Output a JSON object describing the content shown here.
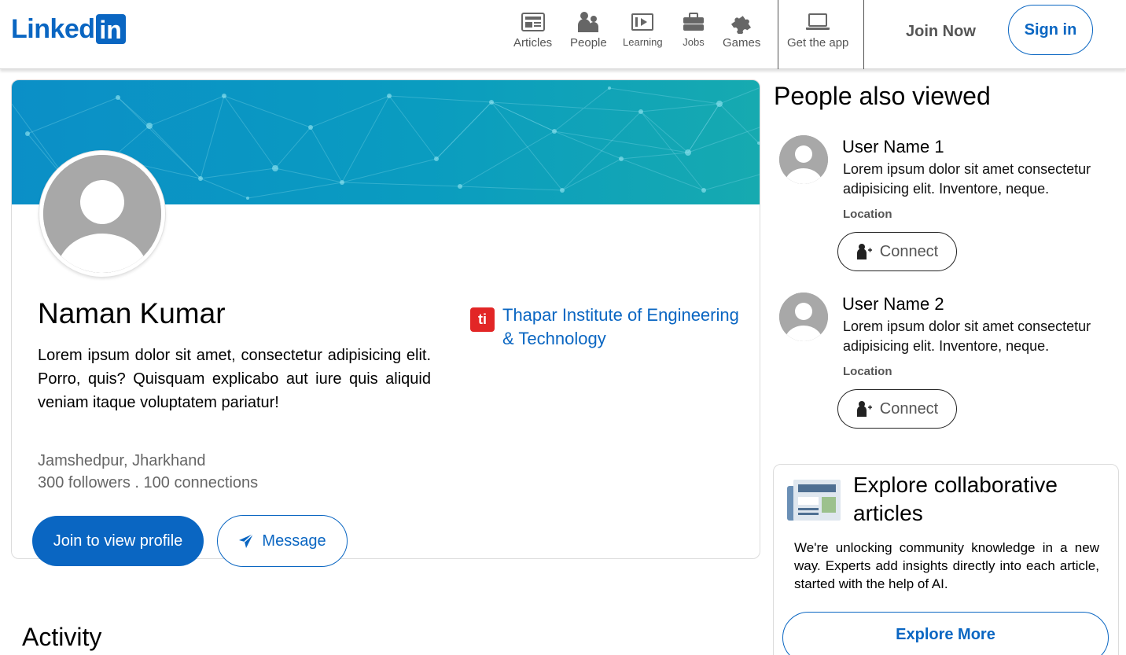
{
  "header": {
    "logo_text": "Linked",
    "logo_box": "in",
    "nav": [
      {
        "label": "Articles",
        "icon": "articles-icon"
      },
      {
        "label": "People",
        "icon": "people-icon"
      },
      {
        "label": "Learning",
        "icon": "learning-icon"
      },
      {
        "label": "Jobs",
        "icon": "jobs-icon"
      },
      {
        "label": "Games",
        "icon": "games-icon"
      }
    ],
    "get_app": {
      "label": "Get the app",
      "icon": "laptop-icon"
    },
    "join_now": "Join Now",
    "sign_in": "Sign in"
  },
  "profile": {
    "name": "Naman Kumar",
    "bio": "Lorem ipsum dolor sit amet, consectetur adipisicing elit. Porro, quis? Quisquam explicabo aut iure quis aliquid veniam itaque voluptatem pariatur!",
    "location": "Jamshedpur, Jharkhand",
    "stats": "300 followers . 100 connections",
    "education": {
      "name": "Thapar Institute of Engineering & Technology",
      "logo": "ti"
    },
    "join_button": "Join to view profile",
    "message_button": "Message"
  },
  "activity_heading": "Activity",
  "people_also_viewed": {
    "title": "People also viewed",
    "people": [
      {
        "name": "User Name 1",
        "desc": "Lorem ipsum dolor sit amet consectetur adipisicing elit. Inventore, neque.",
        "location": "Location",
        "connect": "Connect"
      },
      {
        "name": "User Name 2",
        "desc": "Lorem ipsum dolor sit amet consectetur adipisicing elit. Inventore, neque.",
        "location": "Location",
        "connect": "Connect"
      }
    ]
  },
  "explore": {
    "title": "Explore collaborative articles",
    "text": "We're unlocking community knowledge in a new way. Experts add insights directly into each article, started with the help of AI.",
    "button": "Explore More"
  },
  "colors": {
    "brand": "#0a66c2",
    "banner_from": "#0b8fc7",
    "banner_to": "#16aab0",
    "school_logo": "#e22626"
  }
}
